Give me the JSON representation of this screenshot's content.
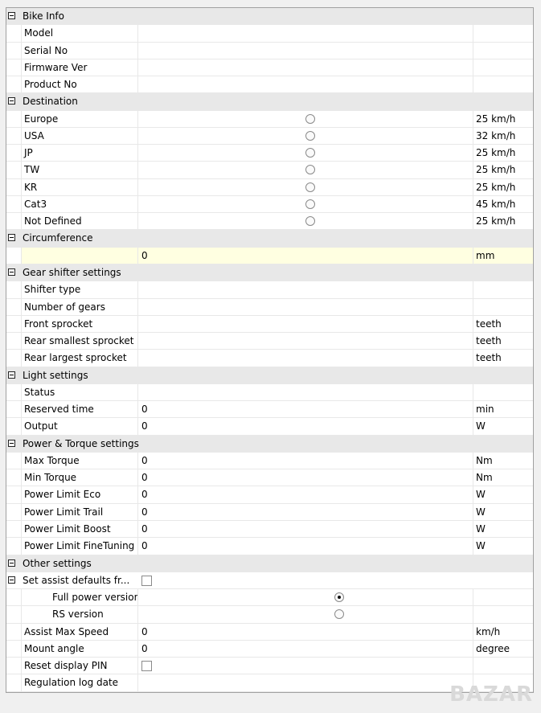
{
  "categories": {
    "bike_info": "Bike Info",
    "destination": "Destination",
    "circumference": "Circumference",
    "gear_shifter": "Gear shifter settings",
    "light": "Light settings",
    "power_torque": "Power & Torque settings",
    "other": "Other settings",
    "set_assist": "Set assist defaults fr..."
  },
  "bike_info": {
    "model": "Model",
    "serial_no": "Serial No",
    "firmware_ver": "Firmware Ver",
    "product_no": "Product No"
  },
  "destination": {
    "europe": {
      "label": "Europe",
      "unit": "25 km/h",
      "selected": false
    },
    "usa": {
      "label": "USA",
      "unit": "32 km/h",
      "selected": false
    },
    "jp": {
      "label": "JP",
      "unit": "25 km/h",
      "selected": false
    },
    "tw": {
      "label": "TW",
      "unit": "25 km/h",
      "selected": false
    },
    "kr": {
      "label": "KR",
      "unit": "25 km/h",
      "selected": false
    },
    "cat3": {
      "label": "Cat3",
      "unit": "45 km/h",
      "selected": false
    },
    "not_defined": {
      "label": "Not Defined",
      "unit": "25 km/h",
      "selected": false
    }
  },
  "circumference": {
    "value": "0",
    "unit": "mm"
  },
  "gear_shifter": {
    "shifter_type": "Shifter type",
    "number_of_gears": "Number of gears",
    "front_sprocket": {
      "label": "Front sprocket",
      "unit": "teeth"
    },
    "rear_smallest": {
      "label": "Rear smallest sprocket",
      "unit": "teeth"
    },
    "rear_largest": {
      "label": "Rear largest sprocket",
      "unit": "teeth"
    }
  },
  "light": {
    "status": "Status",
    "reserved_time": {
      "label": "Reserved time",
      "value": "0",
      "unit": "min"
    },
    "output": {
      "label": "Output",
      "value": "0",
      "unit": "W"
    }
  },
  "power_torque": {
    "max_torque": {
      "label": "Max Torque",
      "value": "0",
      "unit": "Nm"
    },
    "min_torque": {
      "label": "Min Torque",
      "value": "0",
      "unit": "Nm"
    },
    "limit_eco": {
      "label": "Power Limit Eco",
      "value": "0",
      "unit": "W"
    },
    "limit_trail": {
      "label": "Power Limit Trail",
      "value": "0",
      "unit": "W"
    },
    "limit_boost": {
      "label": "Power Limit Boost",
      "value": "0",
      "unit": "W"
    },
    "limit_finetuning": {
      "label": "Power Limit FineTuning",
      "value": "0",
      "unit": "W"
    }
  },
  "set_assist": {
    "checked": false,
    "full_power": {
      "label": "Full power version",
      "selected": true
    },
    "rs_version": {
      "label": "RS version",
      "selected": false
    }
  },
  "other": {
    "assist_max_speed": {
      "label": "Assist Max Speed",
      "value": "0",
      "unit": "km/h"
    },
    "mount_angle": {
      "label": "Mount angle",
      "value": "0",
      "unit": "degree"
    },
    "reset_display_pin": {
      "label": "Reset display PIN",
      "checked": false
    },
    "regulation_log_date": "Regulation log date"
  },
  "watermark": "BAZAR"
}
